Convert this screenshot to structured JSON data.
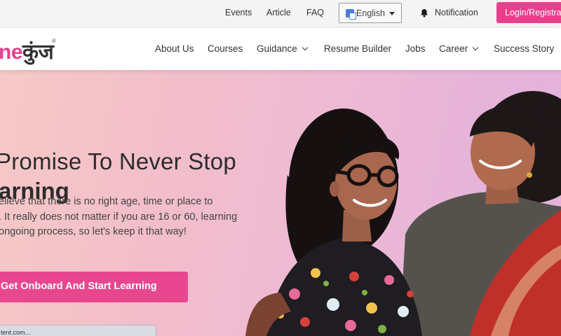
{
  "topbar": {
    "events": "Events",
    "article": "Article",
    "faq": "FAQ",
    "language": "English",
    "notification": "Notification",
    "login": "Login/Registration"
  },
  "logo": {
    "part1": "ne",
    "part2": "कुंज",
    "reg": "®"
  },
  "nav": {
    "about": "About Us",
    "courses": "Courses",
    "guidance": "Guidance",
    "resume": "Resume Builder",
    "jobs": "Jobs",
    "career": "Career",
    "success": "Success Story"
  },
  "hero": {
    "heading_line1": "Promise To Never Stop",
    "heading_line2": "arning",
    "para_line1": "elieve that there is no right age, time or place to",
    "para_line2": ". It really does not matter if you are 16 or 60, learning",
    "para_line3": "ongoing process, so let's keep it that way!",
    "cta": "Get Onboard And Start Learning"
  },
  "status_bar": {
    "text": "tent.com..."
  },
  "icons": {
    "language": "google-translate-icon",
    "dropdown": "caret-down-icon",
    "notification": "bell-icon",
    "nav_dropdown": "chevron-down-icon"
  },
  "colors": {
    "brand": "#e83e8c",
    "cta": "#e8478f"
  }
}
